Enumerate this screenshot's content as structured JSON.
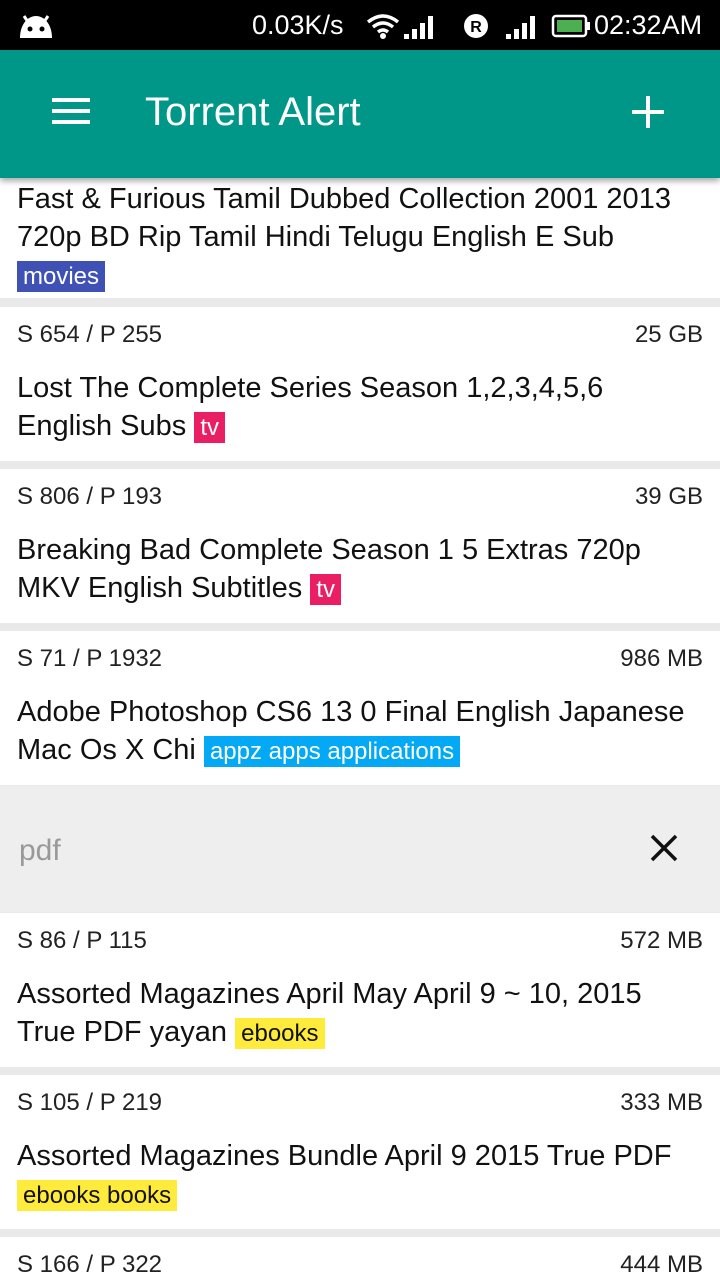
{
  "status_bar": {
    "speed": "0.03K/s",
    "time": "02:32AM",
    "icons": [
      "android-icon",
      "wifi-icon",
      "signal-icon",
      "roaming-icon",
      "signal-icon",
      "battery-icon"
    ]
  },
  "app_bar": {
    "title": "Torrent Alert",
    "menu_icon": "menu-icon",
    "add_icon": "add-icon"
  },
  "search": {
    "value": "",
    "placeholder": "pdf",
    "clear_icon": "close-icon"
  },
  "items_top": [
    {
      "seeds_peers": "",
      "size": "",
      "title": "Fast & Furious Tamil Dubbed Collection 2001 2013 720p BD Rip Tamil Hindi Telugu English E Sub",
      "tag": "movies"
    },
    {
      "seeds_peers": "S 654 / P 255",
      "size": "25 GB",
      "title": "Lost The Complete Series Season 1,2,3,4,5,6 English Subs",
      "tag": "tv"
    },
    {
      "seeds_peers": "S 806 / P 193",
      "size": "39 GB",
      "title": "Breaking Bad Complete Season 1 5 Extras 720p MKV English Subtitles",
      "tag": "tv"
    },
    {
      "seeds_peers": "S 71 / P 1932",
      "size": "986 MB",
      "title": "Adobe Photoshop CS6 13 0 Final English Japanese Mac Os X Chi",
      "tag": "appz apps applications"
    }
  ],
  "items_bottom": [
    {
      "seeds_peers": "S 86 / P 115",
      "size": "572 MB",
      "title": "Assorted Magazines April May April 9 ~ 10, 2015 True PDF yayan",
      "tag": "ebooks"
    },
    {
      "seeds_peers": "S 105 / P 219",
      "size": "333 MB",
      "title": "Assorted Magazines Bundle April 9 2015 True PDF",
      "tag": "ebooks books"
    },
    {
      "seeds_peers": "S 166 / P 322",
      "size": "444 MB",
      "title": "",
      "tag": ""
    }
  ],
  "colors": {
    "primary": "#009688",
    "tag_movies": "#3f51b5",
    "tag_tv": "#e91e63",
    "tag_appz": "#03a9f4",
    "tag_ebooks": "#ffeb3b"
  }
}
